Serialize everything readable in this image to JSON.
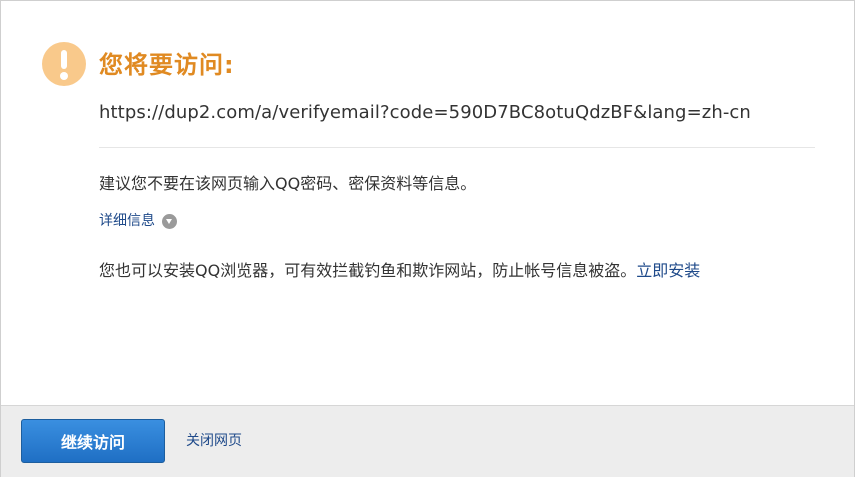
{
  "warning": {
    "icon": "exclamation-circle-icon",
    "icon_color": "#f9c98b",
    "title": "您将要访问:",
    "title_color": "#e08a22"
  },
  "url": "https://dup2.com/a/verifyemail?code=590D7BC8otuQdzBF&lang=zh-cn",
  "advice_text": "建议您不要在该网页输入QQ密码、密保资料等信息。",
  "details": {
    "label": "详细信息",
    "icon": "chevron-down-icon"
  },
  "promo": {
    "text": "您也可以安装QQ浏览器，可有效拦截钓鱼和欺诈网站，防止帐号信息被盗。",
    "install_link": "立即安装"
  },
  "footer": {
    "continue_label": "继续访问",
    "close_label": "关闭网页"
  },
  "colors": {
    "link": "#1f4a8a",
    "button": "#2a7fd4",
    "footer_bg": "#ededed"
  }
}
